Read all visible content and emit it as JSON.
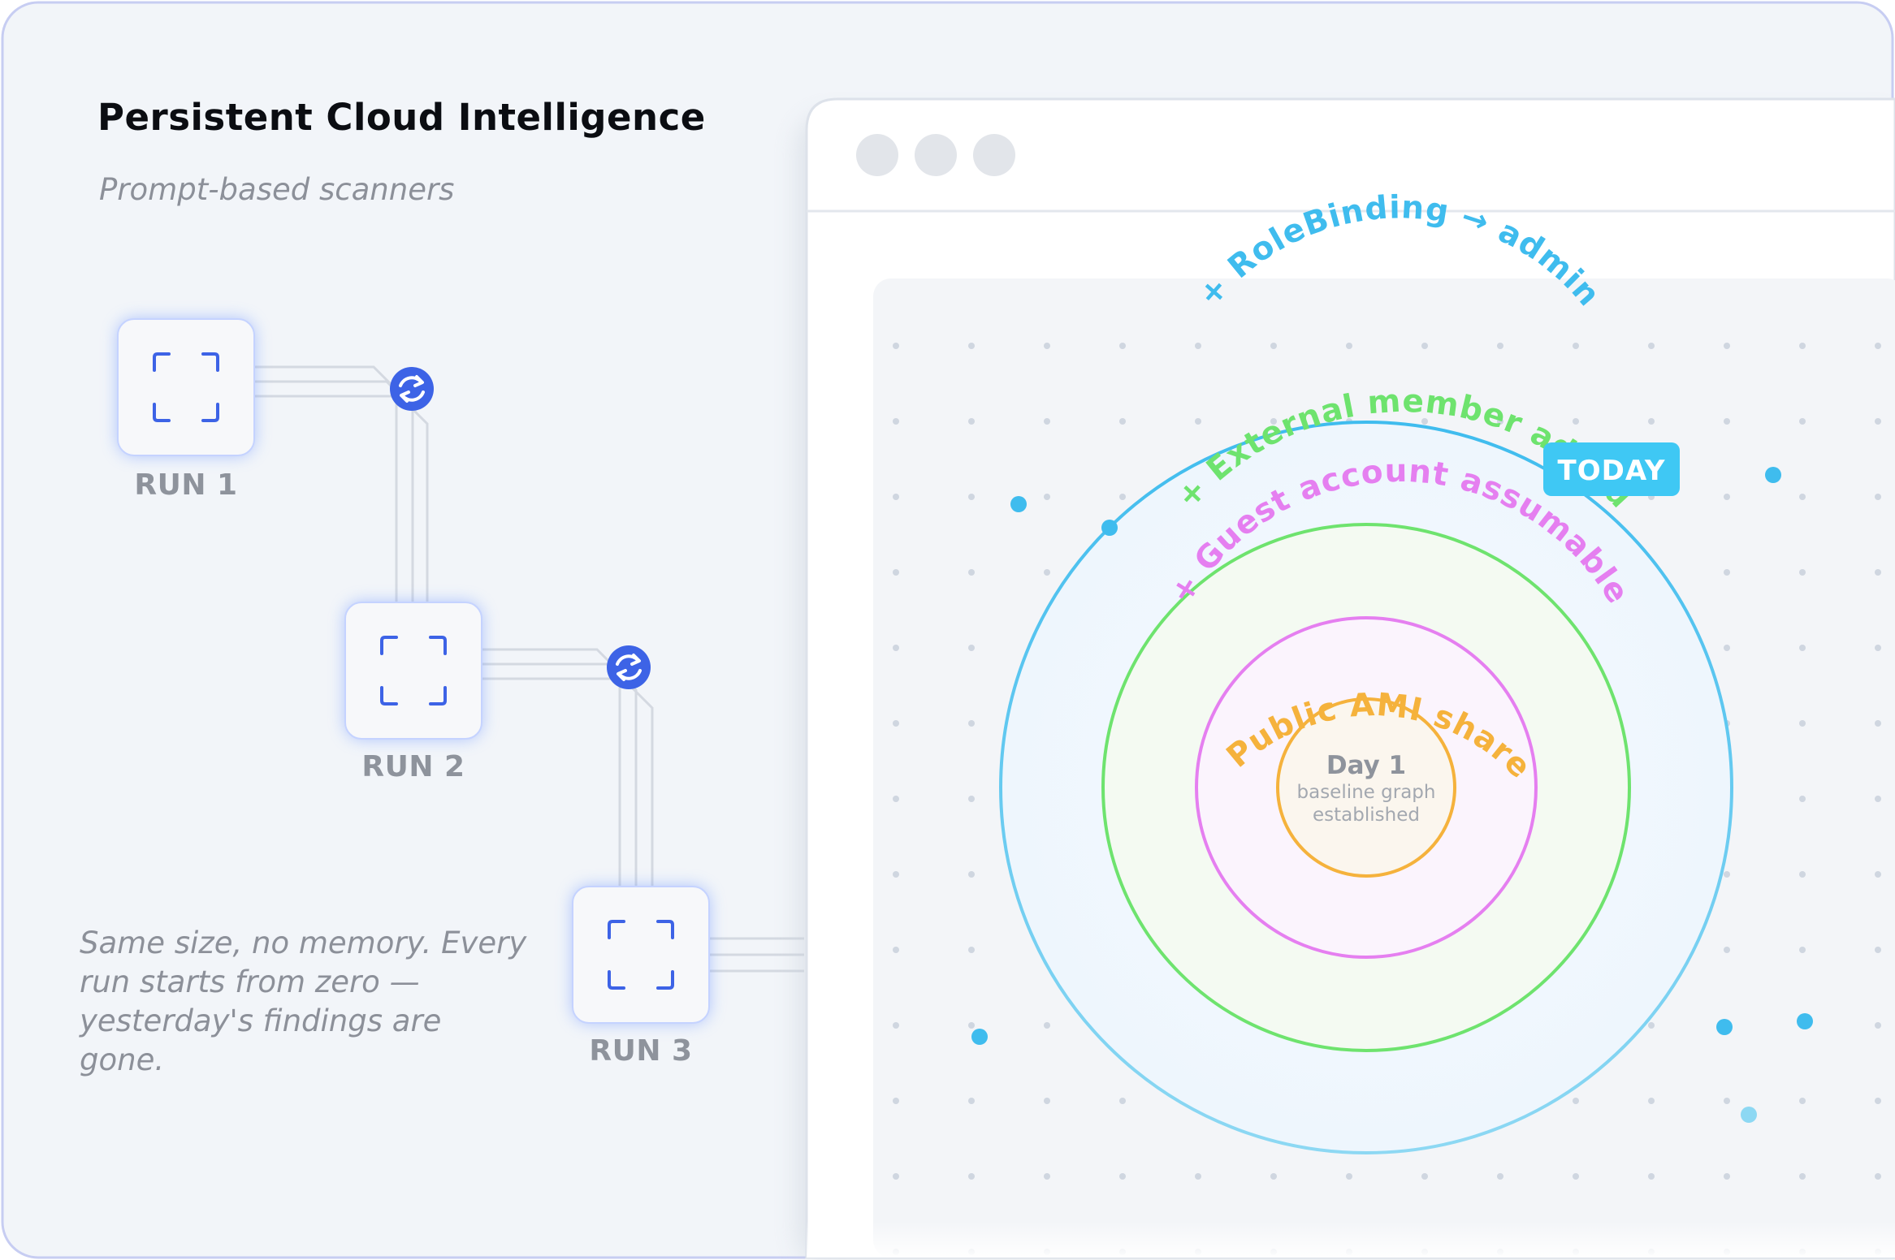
{
  "header": {
    "title": "Persistent Cloud Intelligence",
    "subtitle": "Prompt-based scanners"
  },
  "runs": [
    {
      "label": "RUN 1"
    },
    {
      "label": "RUN 2"
    },
    {
      "label": "RUN 3"
    }
  ],
  "note": "Same size, no memory. Every run starts from zero — yesterday's findings are gone.",
  "window": {
    "rings": [
      {
        "label": "+ RoleBinding → admin",
        "color": "#3fbcee"
      },
      {
        "label": "+ External member added",
        "color": "#6ee36e"
      },
      {
        "label": "+ Guest account assumable",
        "color": "#e57ff0"
      },
      {
        "label": "+ Public AMI shared",
        "color": "#f5b23c"
      }
    ],
    "center": {
      "title": "Day 1",
      "line1": "baseline graph",
      "line2": "established"
    },
    "badge": "TODAY"
  },
  "colors": {
    "accent_blue": "#3d63e6",
    "cyan": "#3fbcee",
    "green": "#6ee36e",
    "pink": "#e57ff0",
    "orange": "#f5b23c"
  }
}
